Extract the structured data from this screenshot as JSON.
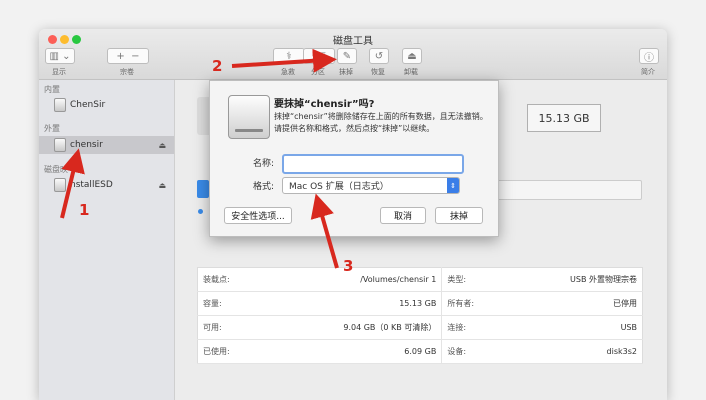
{
  "window": {
    "title": "磁盘工具"
  },
  "toolbar": {
    "view_label": "显示",
    "volume_label": "宗卷",
    "firstaid_label": "急救",
    "partition_btn": "分区",
    "partition_label": "分区",
    "erase_label": "抹掉",
    "restore_label": "恢复",
    "unmount_label": "卸载",
    "info_label": "简介"
  },
  "sidebar": {
    "internal_header": "内置",
    "internal_item": "ChenSir",
    "external_header": "外置",
    "external_item": "chensir",
    "disk_image_header": "磁盘映",
    "disk_image_item": "nstallESD"
  },
  "main": {
    "capacity": "15.13 GB"
  },
  "dialog": {
    "title": "要抹掉“chensir”吗?",
    "description": "抹掉“chensir”将删除储存在上面的所有数据，且无法撤销。请提供名称和格式，然后点按“抹掉”以继续。",
    "name_label": "名称:",
    "name_value": "",
    "format_label": "格式:",
    "format_value": "Mac OS 扩展（日志式）",
    "security_btn": "安全性选项...",
    "cancel_btn": "取消",
    "erase_btn": "抹掉"
  },
  "info": {
    "rows": [
      {
        "k1": "装载点:",
        "v1": "/Volumes/chensir 1",
        "k2": "类型:",
        "v2": "USB 外置物理宗卷"
      },
      {
        "k1": "容量:",
        "v1": "15.13 GB",
        "k2": "所有者:",
        "v2": "已停用"
      },
      {
        "k1": "可用:",
        "v1": "9.04 GB（0 KB 可清除）",
        "k2": "连接:",
        "v2": "USB"
      },
      {
        "k1": "已使用:",
        "v1": "6.09 GB",
        "k2": "设备:",
        "v2": "disk3s2"
      }
    ]
  },
  "annotations": {
    "n1": "1",
    "n2": "2",
    "n3": "3"
  },
  "colors": {
    "arrow": "#d8281e",
    "accent": "#3a8be8"
  },
  "icons": {
    "sidebar_toggle": "sidebar-icon",
    "plus": "plus-icon",
    "minus": "minus-icon",
    "firstaid": "stethoscope-icon",
    "erase": "erase-icon",
    "restore": "restore-icon",
    "unmount": "unmount-icon",
    "info": "info-icon"
  }
}
